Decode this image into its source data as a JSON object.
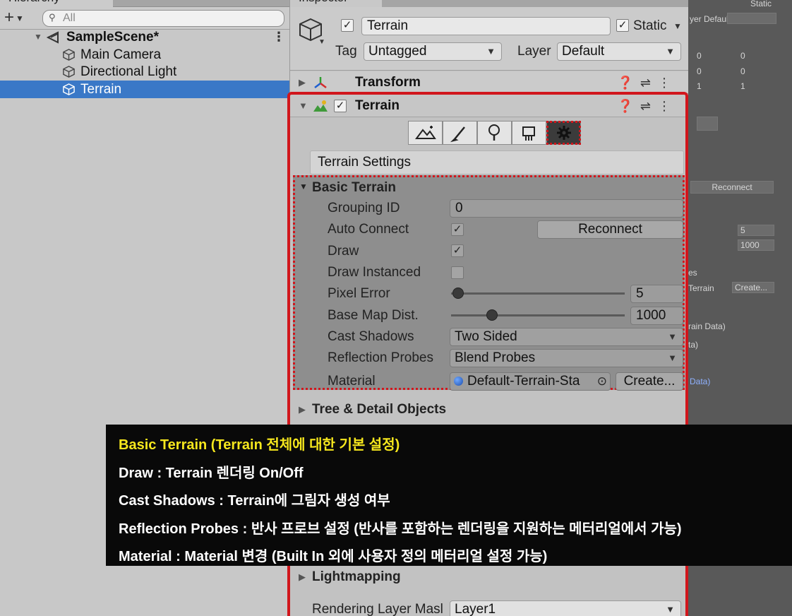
{
  "hierarchy": {
    "tab_label": "Hierarchy",
    "add_symbol": "+",
    "search_placeholder": "All",
    "scene_name": "SampleScene*",
    "items": [
      {
        "label": "Main Camera"
      },
      {
        "label": "Directional Light"
      },
      {
        "label": "Terrain"
      }
    ]
  },
  "inspector": {
    "tab_label": "Inspector",
    "object_name": "Terrain",
    "static_label": "Static",
    "tag_label": "Tag",
    "tag_value": "Untagged",
    "layer_label": "Layer",
    "layer_value": "Default",
    "transform_title": "Transform",
    "terrain_title": "Terrain",
    "settings_title": "Terrain Settings",
    "basic": {
      "title": "Basic Terrain",
      "grouping_id_label": "Grouping ID",
      "grouping_id_value": "0",
      "auto_connect_label": "Auto Connect",
      "reconnect_label": "Reconnect",
      "draw_label": "Draw",
      "draw_instanced_label": "Draw Instanced",
      "pixel_error_label": "Pixel Error",
      "pixel_error_value": "5",
      "base_map_label": "Base Map Dist.",
      "base_map_value": "1000",
      "cast_shadows_label": "Cast Shadows",
      "cast_shadows_value": "Two Sided",
      "reflection_label": "Reflection Probes",
      "reflection_value": "Blend Probes",
      "material_label": "Material",
      "material_value": "Default-Terrain-Sta",
      "create_label": "Create..."
    },
    "tree_title": "Tree & Detail Objects",
    "lightmapping_title": "Lightmapping",
    "rendering_layer_label": "Rendering Layer Masl",
    "rendering_layer_value": "Layer1"
  },
  "background_panel": {
    "static_label": "Static",
    "layer_text": "yer  Default",
    "x0": "0",
    "z0": "0",
    "x1": "0",
    "z1": "0",
    "x2": "1",
    "z2": "1",
    "reconnect": "Reconnect",
    "v5": "5",
    "v1000": "1000",
    "es": "es",
    "terrain": "Terrain",
    "create": "Create...",
    "rain_data": "rain Data)",
    "ta": "ta)",
    "data": "Data)"
  },
  "subtitle": {
    "line1": "Basic Terrain (Terrain 전체에 대한 기본 설정)",
    "line2": "Draw : Terrain 렌더링 On/Off",
    "line3": "Cast Shadows : Terrain에 그림자 생성 여부",
    "line4": "Reflection Probes : 반사 프로브 설정 (반사를 포함하는 렌더링을 지원하는 메터리얼에서 가능)",
    "line5": "Material : Material 변경 (Built In 외에 사용자 정의 메터리얼 설정 가능)"
  },
  "colors": {
    "selection": "#3a78c7",
    "highlight_red": "#d1161c",
    "subtitle_title": "#f6e71d",
    "subtitle_bg": "#090909"
  }
}
